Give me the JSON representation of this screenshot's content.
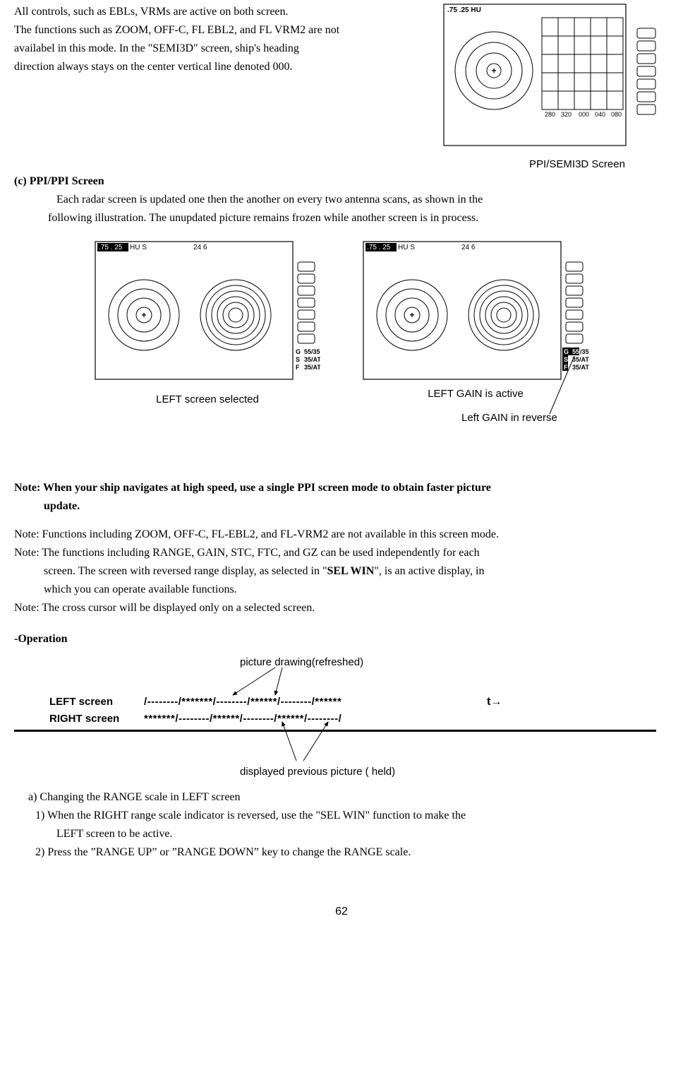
{
  "intro": {
    "l1": "All controls, such as EBLs, VRMs are active on both screen.",
    "l2": "The functions such as ZOOM, OFF-C, FL EBL2, and FL VRM2 are not",
    "l3": "availabel in this mode. In the \"SEMI3D\" screen, ship's heading",
    "l4": "direction always stays on the center vertical line denoted 000."
  },
  "fig1": {
    "header": ".75  .25  HU",
    "ticks": [
      "280",
      "320",
      "000",
      "040",
      "080"
    ],
    "caption": "PPI/SEMI3D Screen"
  },
  "sectionC": {
    "title": "(c) PPI/PPI Screen",
    "p1a": "Each radar screen is updated one then the another on every two antenna scans, as shown in the",
    "p1b": "following illustration. The unupdated picture remains frozen while another screen is in process."
  },
  "dual": {
    "header_range": ".75  . 25",
    "header_mode": " HU S",
    "header_right": "24    6",
    "g": "G",
    "s": "S",
    "f": "F",
    "gv": "55/35",
    "sv": "35/AT",
    "fv": "35/AT",
    "cap_left": "LEFT screen selected",
    "cap_right": "LEFT GAIN is active",
    "reverse_label": "Left GAIN in reverse"
  },
  "notes": {
    "n1a": "Note: When your ship navigates at high speed, use a single PPI screen mode to obtain faster picture",
    "n1b": "update.",
    "n2": "Note: Functions including ZOOM, OFF-C, FL-EBL2, and FL-VRM2 are not available in this screen mode.",
    "n3a": "Note: The functions including RANGE, GAIN, STC, FTC, and GZ can be used independently for each",
    "n3b_pre": "screen. The screen with reversed range display, as selected in \"",
    "n3b_bold": "SEL WIN",
    "n3b_post": "\", is an active display, in",
    "n3c": "which you can operate available functions.",
    "n4": "Note: The cross cursor will be displayed only on a selected screen."
  },
  "operation": {
    "heading": "-Operation",
    "top_label": "picture drawing(refreshed)",
    "left_label": "LEFT screen",
    "right_label": "RIGHT screen",
    "left_pattern": "/--------/*******/--------/******/--------/******",
    "right_pattern": "*******/--------/******/--------/******/--------/",
    "t": "t→",
    "bottom_label": "displayed previous picture ( held)"
  },
  "subA": {
    "title": "a) Changing the RANGE scale in LEFT screen",
    "s1a": "1) When the RIGHT range scale indicator is reversed, use the \"SEL WIN\" function to make the",
    "s1b": "LEFT screen to be active.",
    "s2": "2) Press the ”RANGE UP” or ”RANGE DOWN” key to change the RANGE scale."
  },
  "page": "62"
}
